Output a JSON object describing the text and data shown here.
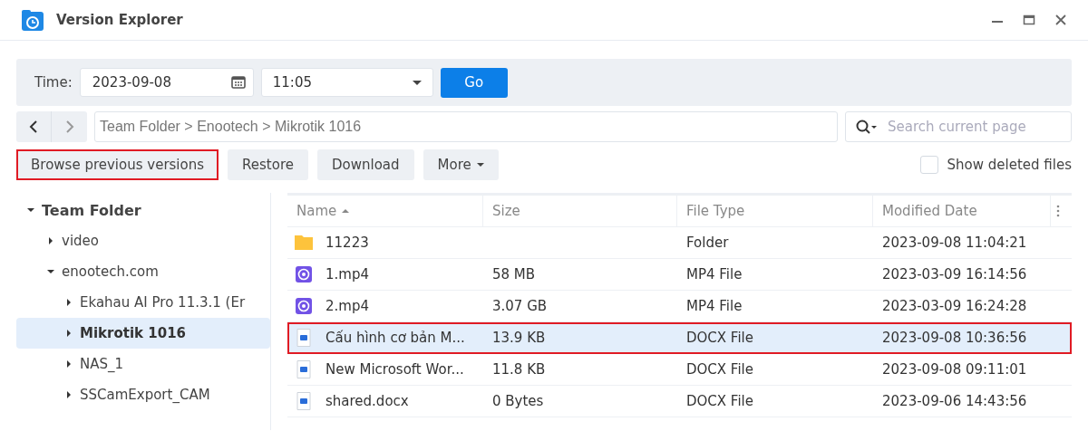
{
  "window": {
    "title": "Version Explorer"
  },
  "time_bar": {
    "label": "Time:",
    "date": "2023-09-08",
    "time": "11:05",
    "go": "Go"
  },
  "path": {
    "value": "Team Folder > Enootech > Mikrotik 1016"
  },
  "search": {
    "placeholder": "Search current page"
  },
  "actions": [
    {
      "label": "Browse previous versions",
      "highlighted": true,
      "dropdown": false
    },
    {
      "label": "Restore",
      "highlighted": false,
      "dropdown": false
    },
    {
      "label": "Download",
      "highlighted": false,
      "dropdown": false
    },
    {
      "label": "More",
      "highlighted": false,
      "dropdown": true
    }
  ],
  "show_deleted": {
    "label": "Show deleted files",
    "checked": false
  },
  "tree": [
    {
      "label": "Team Folder",
      "expanded": true,
      "selected": false,
      "children": [
        {
          "label": "video",
          "expanded": false,
          "selected": false
        },
        {
          "label": "enootech.com",
          "expanded": true,
          "selected": false,
          "children": [
            {
              "label": "Ekahau AI Pro 11.3.1 (Er",
              "expanded": false,
              "selected": false
            },
            {
              "label": "Mikrotik 1016",
              "expanded": false,
              "selected": true
            },
            {
              "label": "NAS_1",
              "expanded": false,
              "selected": false
            },
            {
              "label": "SSCamExport_CAM",
              "expanded": false,
              "selected": false
            }
          ]
        }
      ]
    }
  ],
  "table": {
    "columns": [
      {
        "label": "Name",
        "sorted": true
      },
      {
        "label": "Size",
        "sorted": false
      },
      {
        "label": "File Type",
        "sorted": false
      },
      {
        "label": "Modified Date",
        "sorted": false
      }
    ],
    "rows": [
      {
        "kind": "folder",
        "name": "11223",
        "size": "",
        "type": "Folder",
        "modified": "2023-09-08 11:04:21",
        "selected": false,
        "highlighted": false
      },
      {
        "kind": "video",
        "name": "1.mp4",
        "size": "58 MB",
        "type": "MP4 File",
        "modified": "2023-03-09 16:14:56",
        "selected": false,
        "highlighted": false
      },
      {
        "kind": "video",
        "name": "2.mp4",
        "size": "3.07 GB",
        "type": "MP4 File",
        "modified": "2023-03-09 16:24:28",
        "selected": false,
        "highlighted": false
      },
      {
        "kind": "doc",
        "name": "Cấu hình cơ bản M...",
        "size": "13.9 KB",
        "type": "DOCX File",
        "modified": "2023-09-08 10:36:56",
        "selected": true,
        "highlighted": true
      },
      {
        "kind": "doc",
        "name": "New Microsoft Wor...",
        "size": "11.8 KB",
        "type": "DOCX File",
        "modified": "2023-09-08 09:11:01",
        "selected": false,
        "highlighted": false
      },
      {
        "kind": "doc",
        "name": "shared.docx",
        "size": "0 Bytes",
        "type": "DOCX File",
        "modified": "2023-09-06 14:43:56",
        "selected": false,
        "highlighted": false
      }
    ]
  }
}
